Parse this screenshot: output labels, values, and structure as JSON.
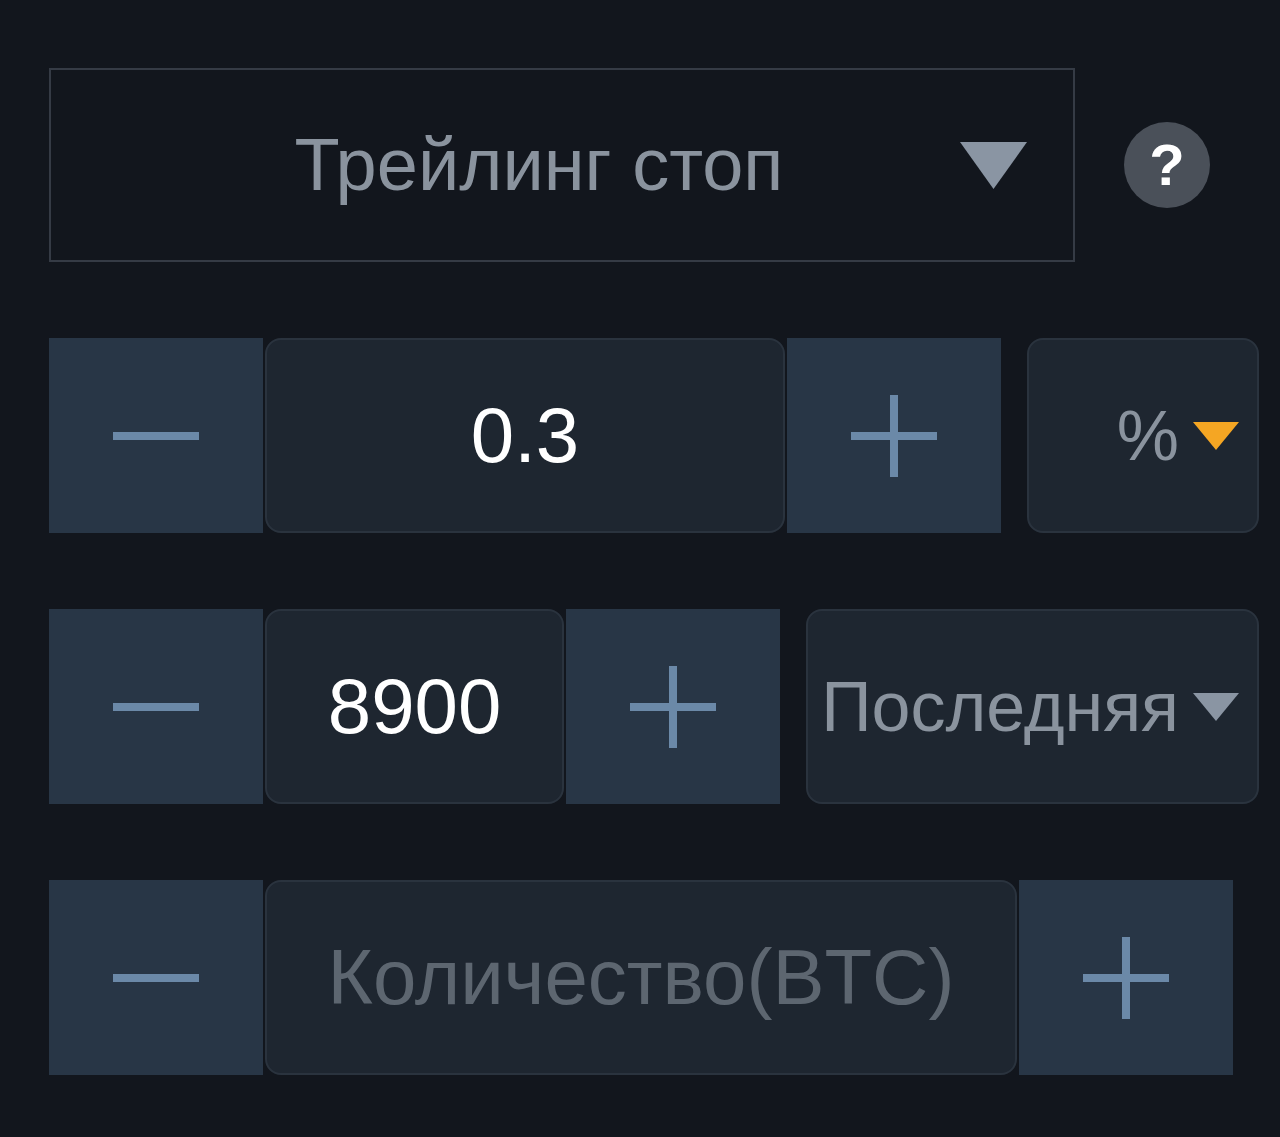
{
  "order_type": {
    "value": "Трейлинг стоп"
  },
  "help": {
    "label": "?"
  },
  "rows": [
    {
      "kind": "stepper_select",
      "field": {
        "value": "0.3"
      },
      "select": {
        "value": "%",
        "color": "#f5a623"
      }
    },
    {
      "kind": "stepper_select",
      "field": {
        "value": "8900"
      },
      "select": {
        "value": "Последняя",
        "color": "#8a95a3"
      }
    },
    {
      "kind": "stepper",
      "field": {
        "placeholder": "Количество(BTC)"
      }
    }
  ]
}
